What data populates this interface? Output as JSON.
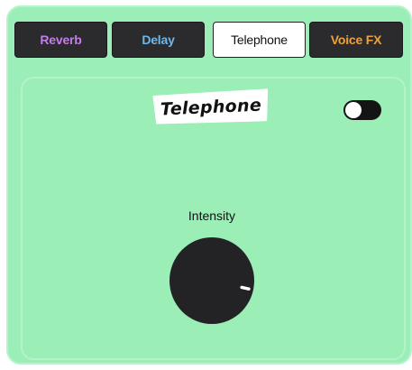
{
  "tabs": [
    {
      "label": "Reverb",
      "color": "#c27ee6",
      "active": false
    },
    {
      "label": "Delay",
      "color": "#6fb7e8",
      "active": false
    },
    {
      "label": "Telephone",
      "color": "#111111",
      "active": true
    },
    {
      "label": "Voice FX",
      "color": "#f0a03c",
      "active": false
    }
  ],
  "effect": {
    "title": "Telephone",
    "enabled": false,
    "knob": {
      "label": "Intensity",
      "value": 0.88
    }
  },
  "colors": {
    "background": "#9beeb8",
    "dial": "#232326",
    "tab_inactive_bg": "#2b2b2d"
  }
}
